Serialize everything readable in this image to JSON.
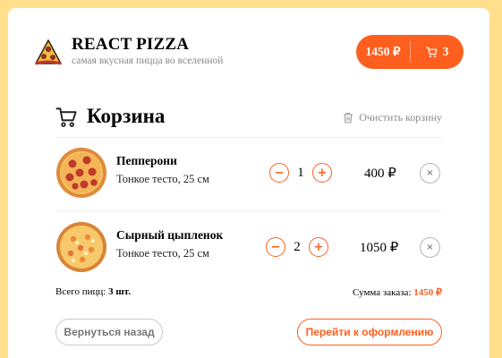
{
  "header": {
    "logo_icon": "pizza-slice-icon",
    "title": "REACT PIZZA",
    "subtitle": "самая вкусная пицца во вселенной",
    "cart_button": {
      "price": "1450 ₽",
      "count": "3",
      "icon": "cart-icon"
    }
  },
  "cart": {
    "title": "Корзина",
    "title_icon": "cart-icon",
    "clear_label": "Очистить корзину",
    "clear_icon": "trash-icon",
    "items": [
      {
        "name": "Пепперони",
        "description": "Тонкое тесто, 25 см",
        "quantity": "1",
        "price": "400 ₽",
        "minus": "−",
        "plus": "+",
        "remove": "×"
      },
      {
        "name": "Сырный цыпленок",
        "description": "Тонкое тесто, 25 см",
        "quantity": "2",
        "price": "1050 ₽",
        "minus": "−",
        "plus": "+",
        "remove": "×"
      }
    ],
    "total_count_label": "Всего пицц:",
    "total_count": "3 шт.",
    "total_sum_label": "Сумма заказа:",
    "total_sum": "1450 ₽",
    "back_label": "Вернуться назад",
    "pay_label": "Перейти к оформлению"
  },
  "colors": {
    "background": "#ffdf8c",
    "accent": "#fe5f1e",
    "card": "#ffffff"
  }
}
